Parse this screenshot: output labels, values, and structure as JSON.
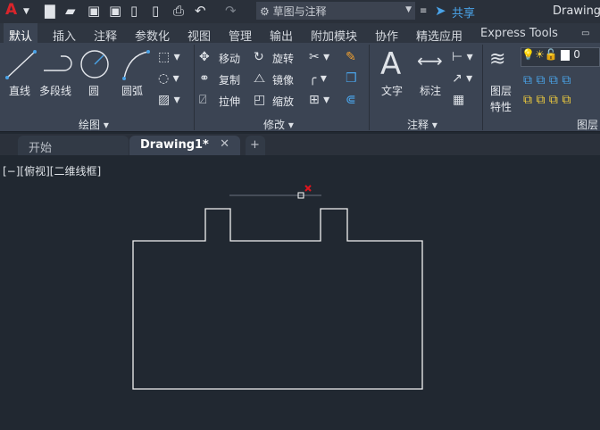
{
  "titlebar": {
    "app_menu": "A",
    "workspace": "草图与注释",
    "share": "共享",
    "title": "Drawing"
  },
  "ribbon_tabs": [
    "默认",
    "插入",
    "注释",
    "参数化",
    "视图",
    "管理",
    "输出",
    "附加模块",
    "协作",
    "精选应用",
    "Express Tools"
  ],
  "draw_panel": {
    "title": "绘图",
    "tools": [
      "直线",
      "多段线",
      "圆",
      "圆弧"
    ]
  },
  "modify_panel": {
    "title": "修改",
    "tools": [
      "移动",
      "旋转",
      "复制",
      "镜像",
      "拉伸",
      "缩放"
    ]
  },
  "annotation_panel": {
    "title": "注释",
    "tools": [
      "文字",
      "标注"
    ]
  },
  "layers_panel": {
    "title": "图层",
    "props_line1": "图层",
    "props_line2": "特性",
    "layer_value": "0"
  },
  "doc_tabs": {
    "start": "开始",
    "active": "Drawing1*",
    "add": "+"
  },
  "viewport": {
    "label": "[−][俯视][二维线框]"
  },
  "colors": {
    "canvas": "#212831",
    "ribbon": "#3b4453",
    "marker": "#e0141e"
  }
}
